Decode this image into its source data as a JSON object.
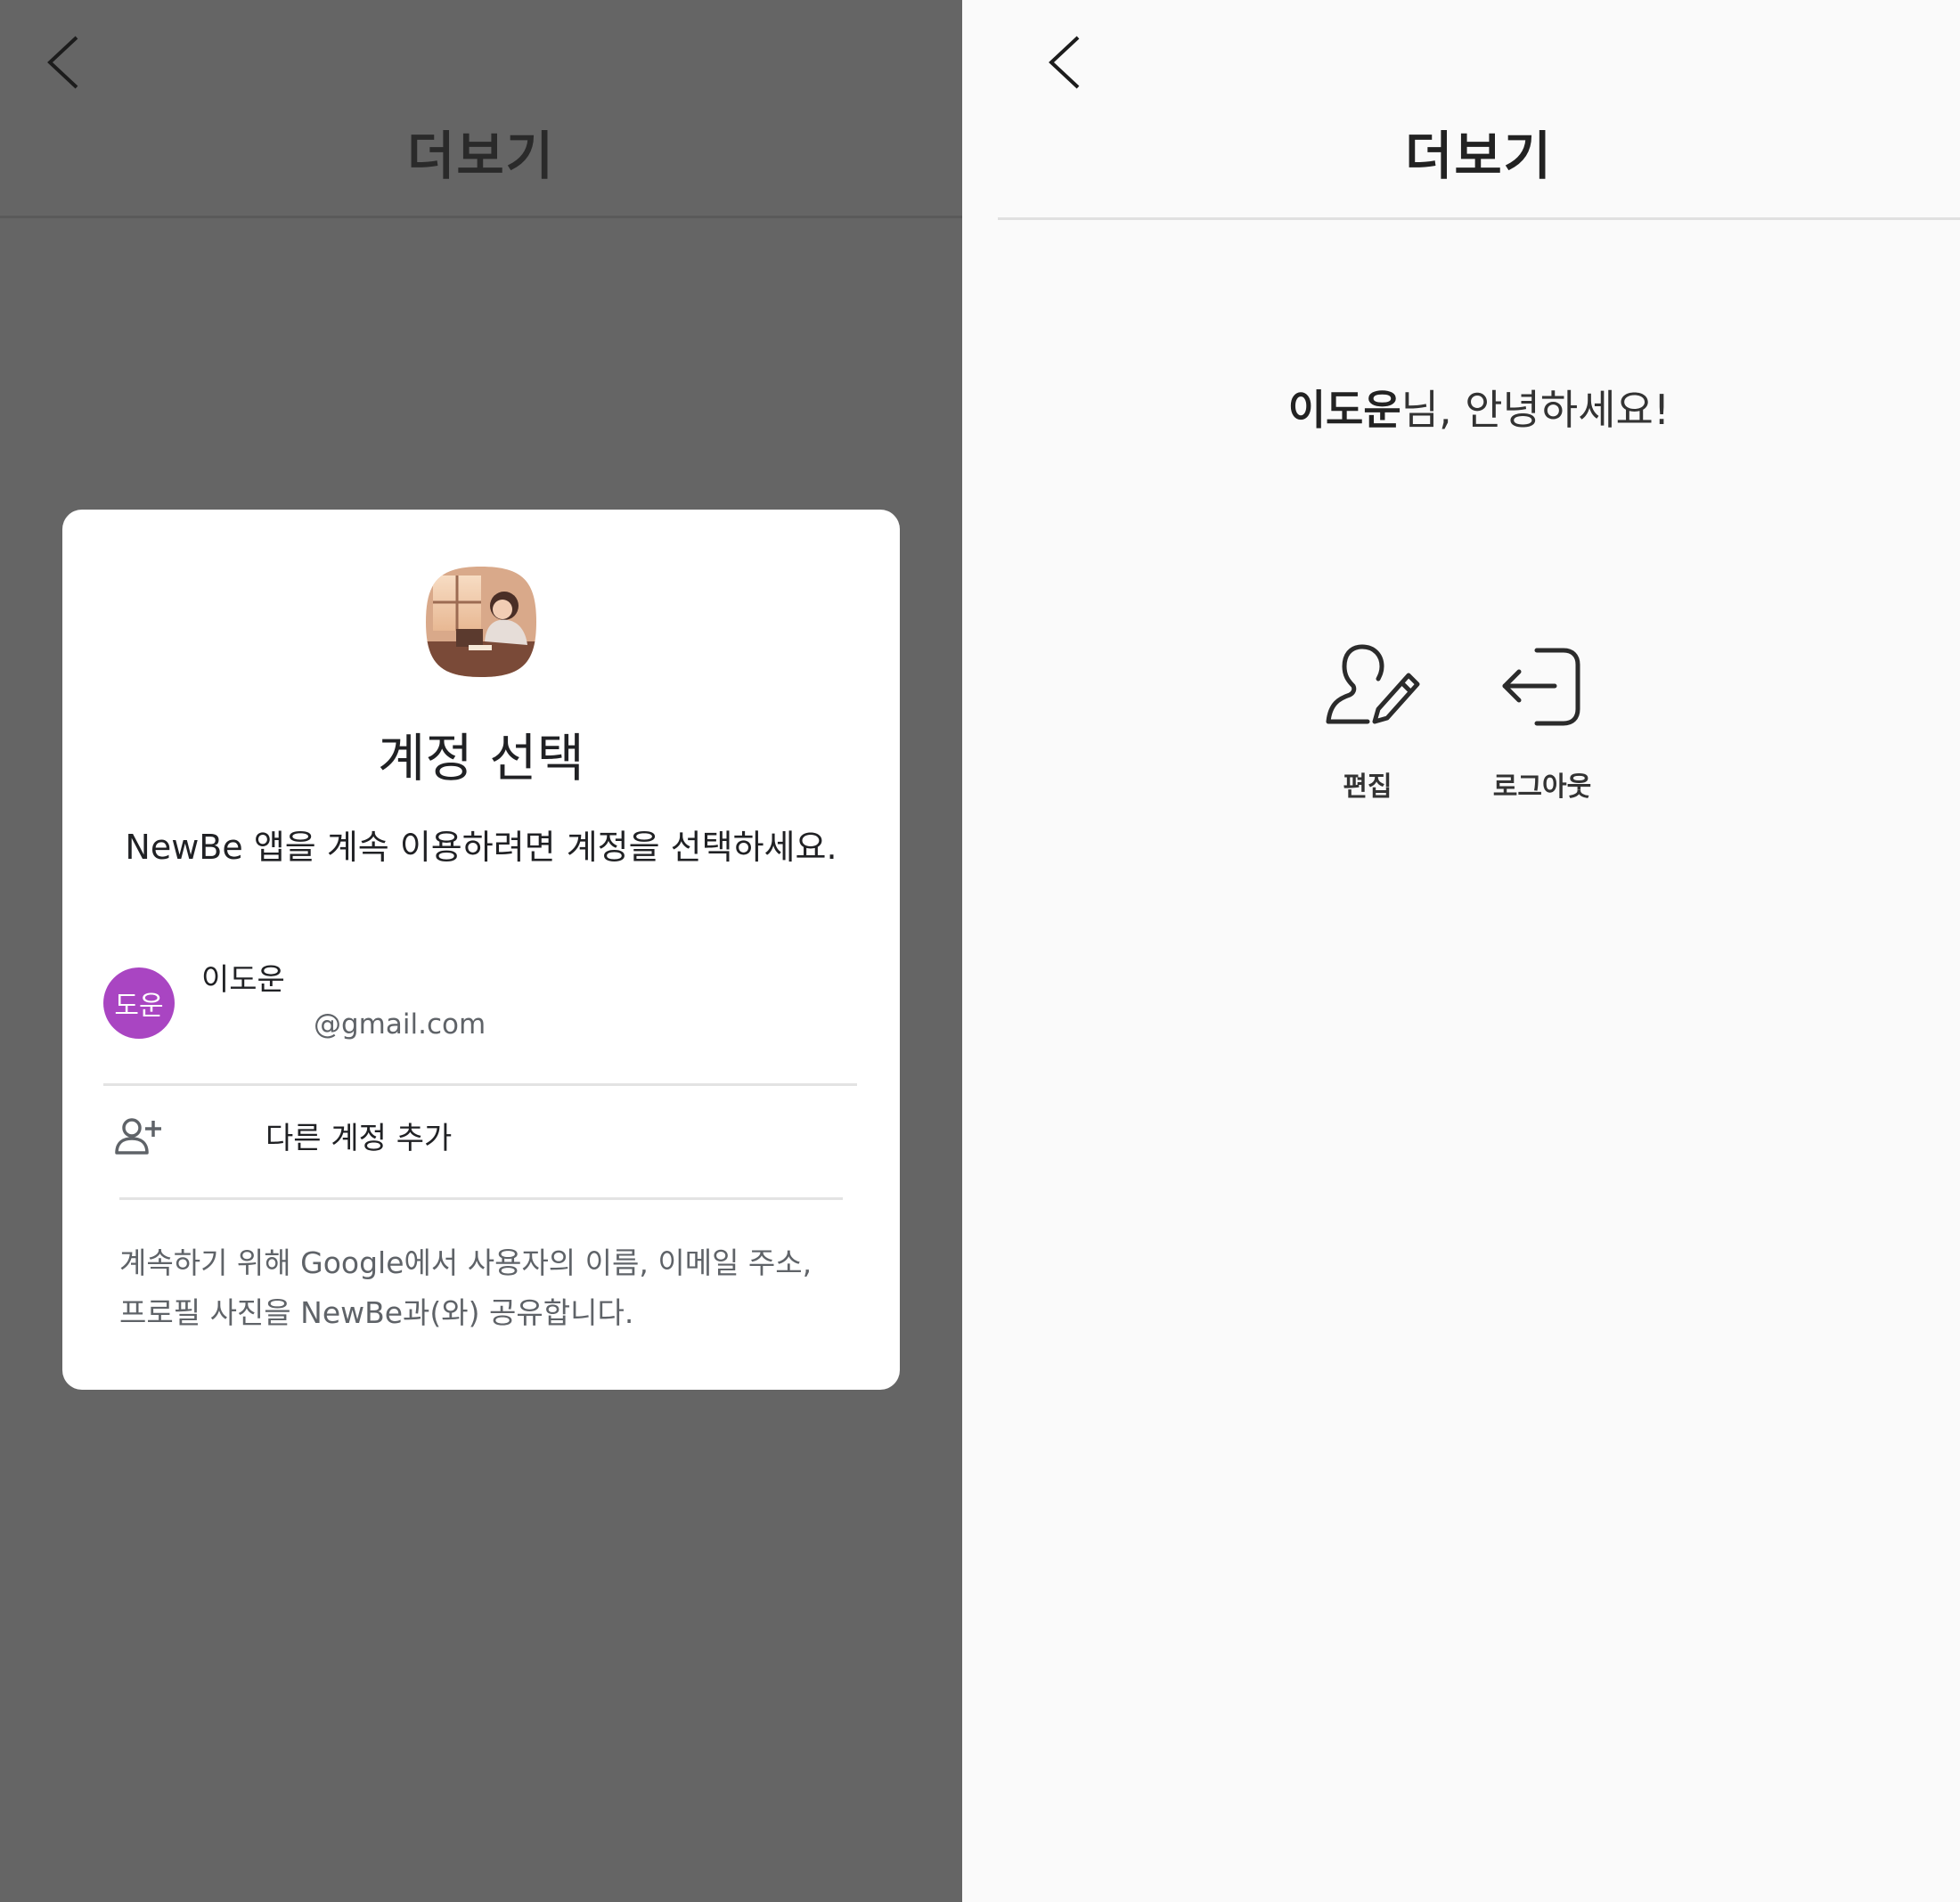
{
  "left_screen": {
    "header": {
      "title": "더보기"
    },
    "dialog": {
      "title": "계정 선택",
      "subtitle": "NewBe 앱을 계속 이용하려면 계정을 선택하세요.",
      "account": {
        "avatar_text": "도운",
        "name": "이도운",
        "email": "@gmail.com"
      },
      "add_account_label": "다른 계정 추가",
      "footer_line1": "계속하기 위해 Google에서 사용자의 이름, 이메일 주소,",
      "footer_line2": "프로필 사진을 NewBe과(와) 공유합니다."
    }
  },
  "right_screen": {
    "header": {
      "title": "더보기"
    },
    "greeting": {
      "name": "이도운",
      "suffix": "님, 안녕하세요!"
    },
    "actions": {
      "edit_label": "편집",
      "logout_label": "로그아웃"
    }
  },
  "colors": {
    "scrim": "#656565",
    "avatar": "#a945c2",
    "right_background": "#fafafa"
  },
  "icons": {
    "back": "chevron-left-icon",
    "app": "app-icon",
    "add_account": "person-add-icon",
    "edit": "person-edit-icon",
    "logout": "logout-icon"
  }
}
